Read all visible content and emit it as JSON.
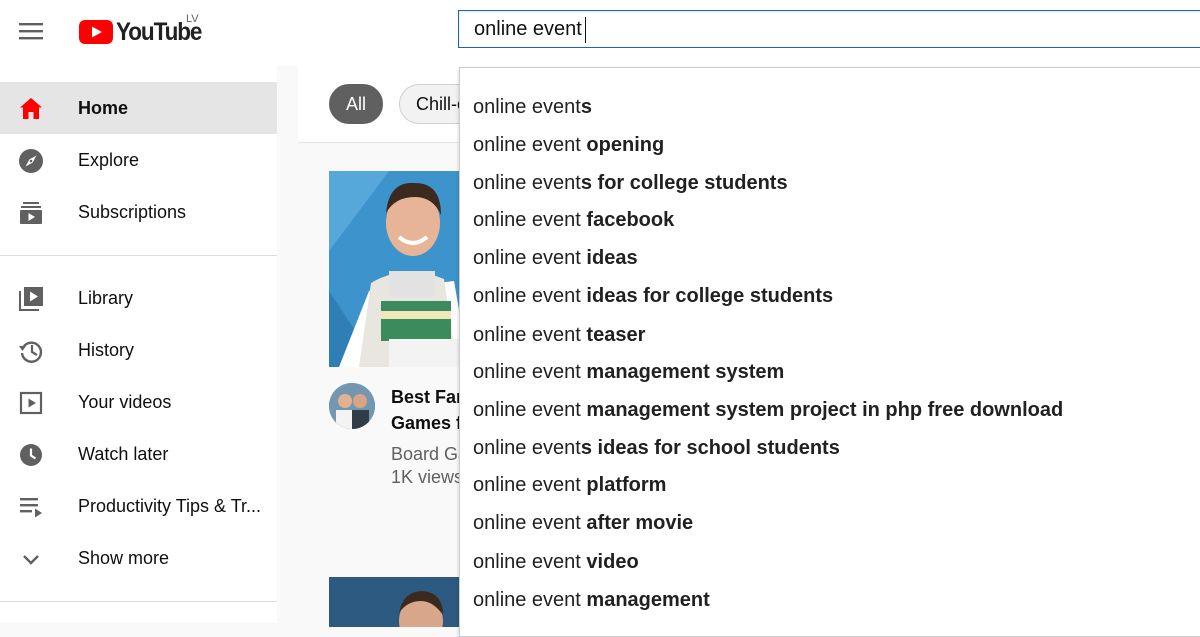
{
  "header": {
    "logo_text": "YouTube",
    "logo_country": "LV",
    "search": {
      "value": "online event",
      "placeholder": ""
    }
  },
  "sidebar": {
    "primary": [
      {
        "label": "Home",
        "icon": "home-icon",
        "active": true
      },
      {
        "label": "Explore",
        "icon": "compass-icon",
        "active": false
      },
      {
        "label": "Subscriptions",
        "icon": "subscriptions-icon",
        "active": false
      }
    ],
    "secondary": [
      {
        "label": "Library",
        "icon": "library-icon"
      },
      {
        "label": "History",
        "icon": "history-icon"
      },
      {
        "label": "Your videos",
        "icon": "play-square-icon"
      },
      {
        "label": "Watch later",
        "icon": "clock-icon"
      },
      {
        "label": "Productivity Tips & Tr...",
        "icon": "playlist-icon"
      },
      {
        "label": "Show more",
        "icon": "chevron-down-icon"
      }
    ]
  },
  "chips": [
    {
      "label": "All",
      "selected": true
    },
    {
      "label": "Chill-o",
      "selected": false
    }
  ],
  "video": {
    "title_line1": "Best Far",
    "title_line2": "Games f",
    "channel": "Board Ga",
    "views": "1K views"
  },
  "suggestions": [
    {
      "prefix": "online event",
      "rest": "s"
    },
    {
      "prefix": "online event",
      "rest": " opening"
    },
    {
      "prefix": "online event",
      "rest": "s for college students"
    },
    {
      "prefix": "online event",
      "rest": " facebook"
    },
    {
      "prefix": "online event",
      "rest": " ideas"
    },
    {
      "prefix": "online event",
      "rest": " ideas for college students"
    },
    {
      "prefix": "online event",
      "rest": " teaser"
    },
    {
      "prefix": "online event",
      "rest": " management system"
    },
    {
      "prefix": "online event",
      "rest": " management system project in php free download"
    },
    {
      "prefix": "online event",
      "rest": "s ideas for school students"
    },
    {
      "prefix": "online event",
      "rest": " platform"
    },
    {
      "prefix": "online event",
      "rest": " after movie"
    },
    {
      "prefix": "online event",
      "rest": " video"
    },
    {
      "prefix": "online event",
      "rest": " management"
    }
  ],
  "colors": {
    "brand_red": "#ff0000",
    "search_border": "#1c62b9",
    "active_bg": "#e5e5e5",
    "chip_selected": "#606060"
  }
}
